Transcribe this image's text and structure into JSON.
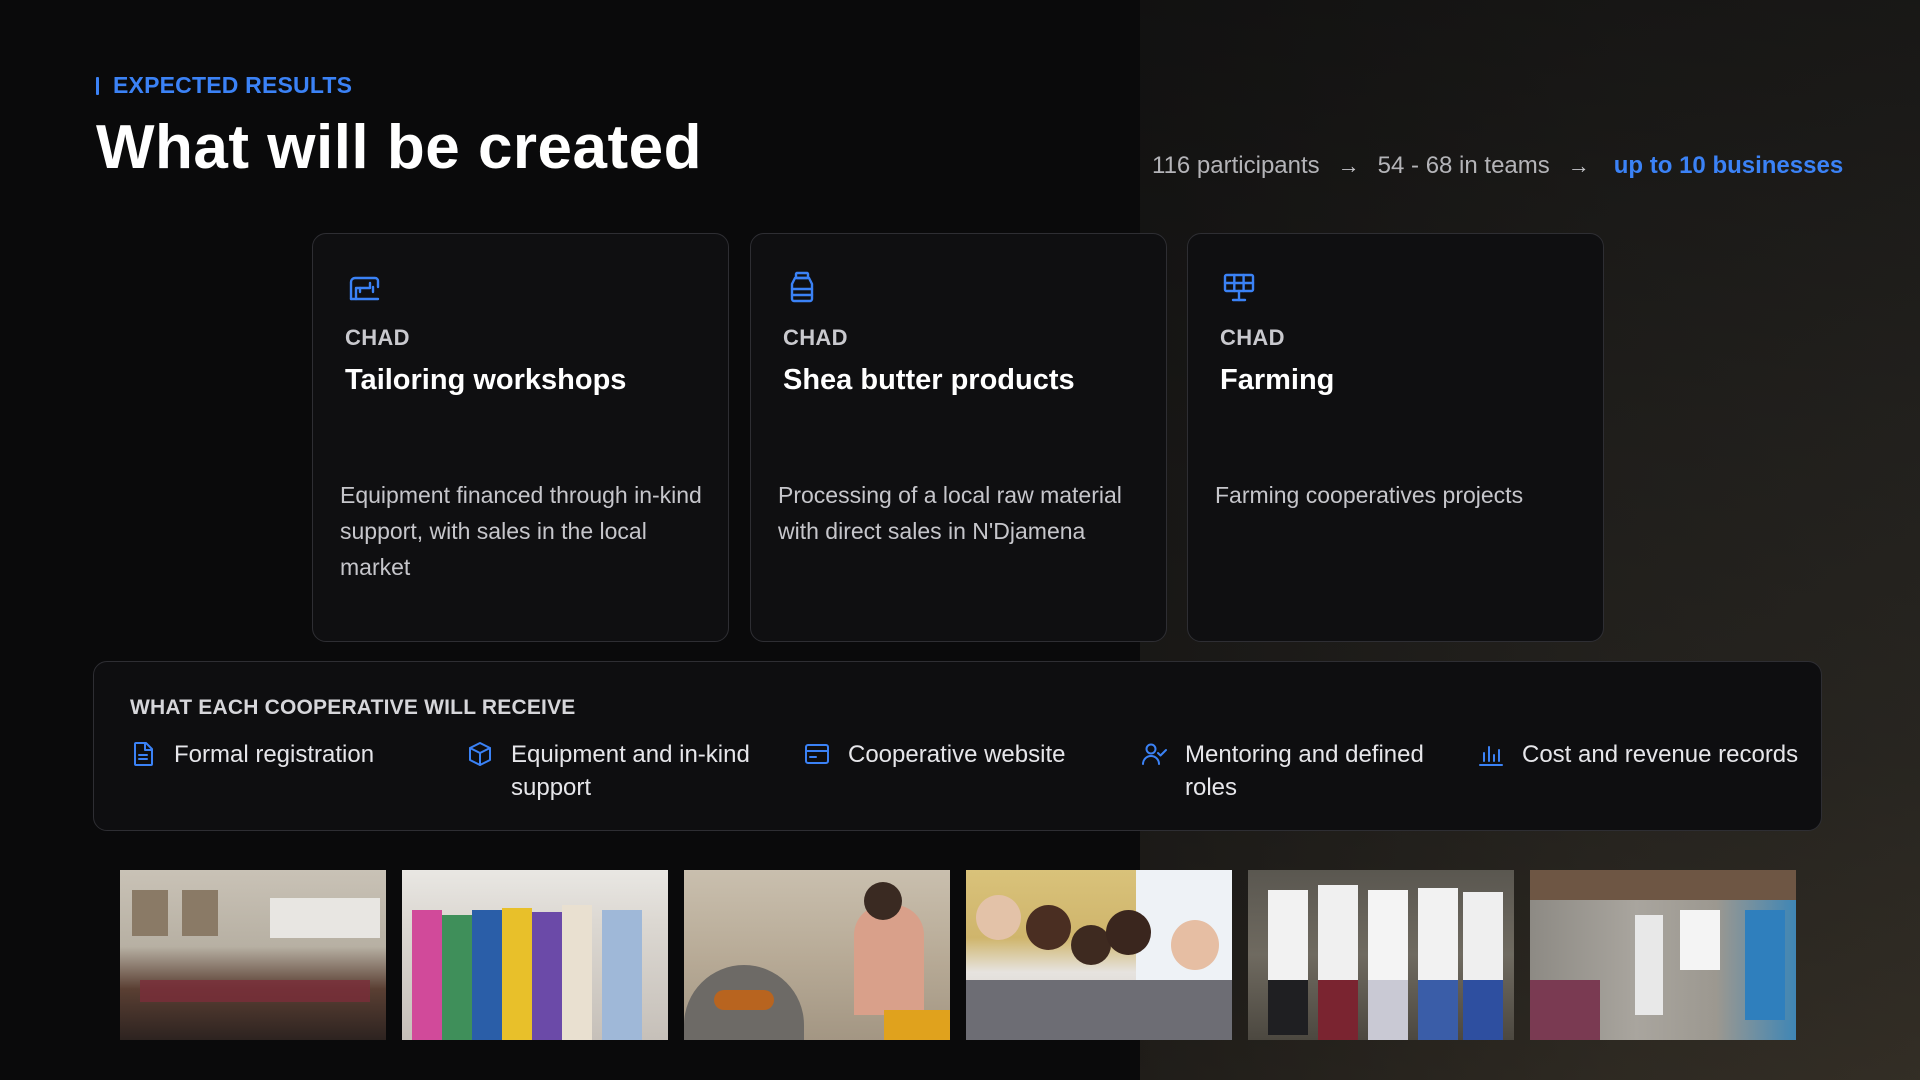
{
  "header": {
    "eyebrow": "EXPECTED RESULTS",
    "title": "What will be created"
  },
  "funnel": {
    "step1": "116 participants",
    "step2": "54 - 68 in teams",
    "step3": "up to 10 businesses",
    "arrow": "→"
  },
  "cards": [
    {
      "icon": "sewing-machine-icon",
      "kicker": "CHAD",
      "title": "Tailoring workshops",
      "description": "Equipment financed through in-kind support, with sales in the local market"
    },
    {
      "icon": "jar-icon",
      "kicker": "CHAD",
      "title": "Shea butter products",
      "description": "Processing of a local raw material with direct sales in N'Djamena"
    },
    {
      "icon": "solar-panel-icon",
      "kicker": "CHAD",
      "title": "Farming",
      "description": "Farming cooperatives projects"
    }
  ],
  "receive": {
    "title": "WHAT EACH COOPERATIVE WILL RECEIVE",
    "items": [
      {
        "icon": "document-icon",
        "label": "Formal registration"
      },
      {
        "icon": "box-icon",
        "label": "Equipment and in-kind support"
      },
      {
        "icon": "browser-icon",
        "label": "Cooperative website"
      },
      {
        "icon": "user-check-icon",
        "label": "Mentoring and defined roles"
      },
      {
        "icon": "bar-chart-icon",
        "label": "Cost and revenue records"
      }
    ]
  },
  "colors": {
    "accent": "#3b82f6",
    "background": "#0a0a0b"
  }
}
